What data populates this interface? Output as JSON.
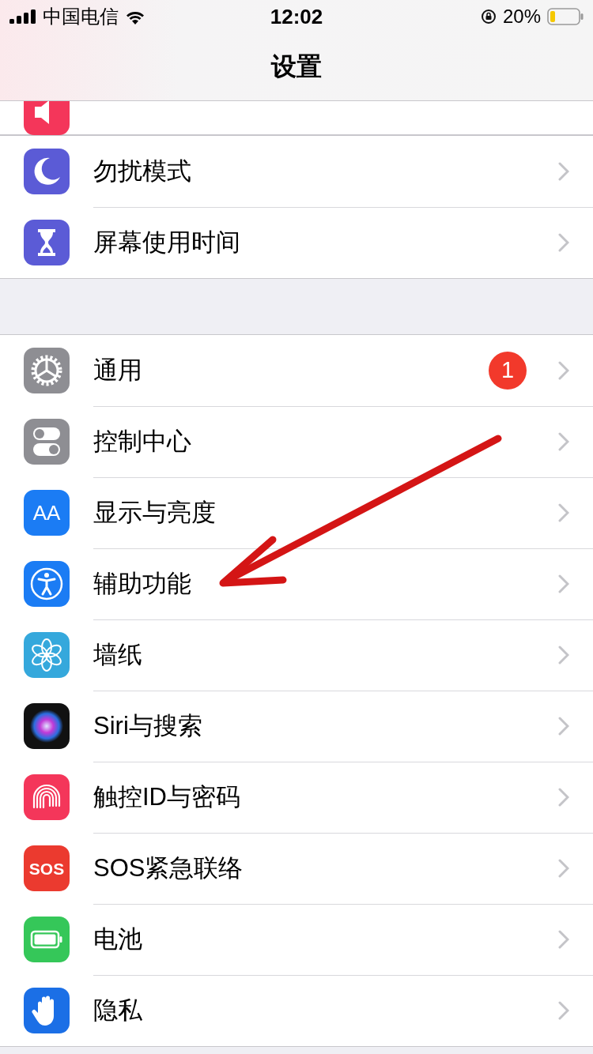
{
  "status_bar": {
    "carrier": "中国电信",
    "time": "12:02",
    "battery_text": "20%"
  },
  "nav": {
    "title": "设置"
  },
  "groups": [
    {
      "items": [
        {
          "label": "勿扰模式"
        },
        {
          "label": "屏幕使用时间"
        }
      ]
    },
    {
      "items": [
        {
          "label": "通用",
          "badge": "1"
        },
        {
          "label": "控制中心"
        },
        {
          "label": "显示与亮度",
          "icon_text": "AA"
        },
        {
          "label": "辅助功能"
        },
        {
          "label": "墙纸"
        },
        {
          "label": "Siri与搜索"
        },
        {
          "label": "触控ID与密码"
        },
        {
          "label": "SOS紧急联络",
          "icon_text": "SOS"
        },
        {
          "label": "电池"
        },
        {
          "label": "隐私"
        }
      ]
    }
  ]
}
